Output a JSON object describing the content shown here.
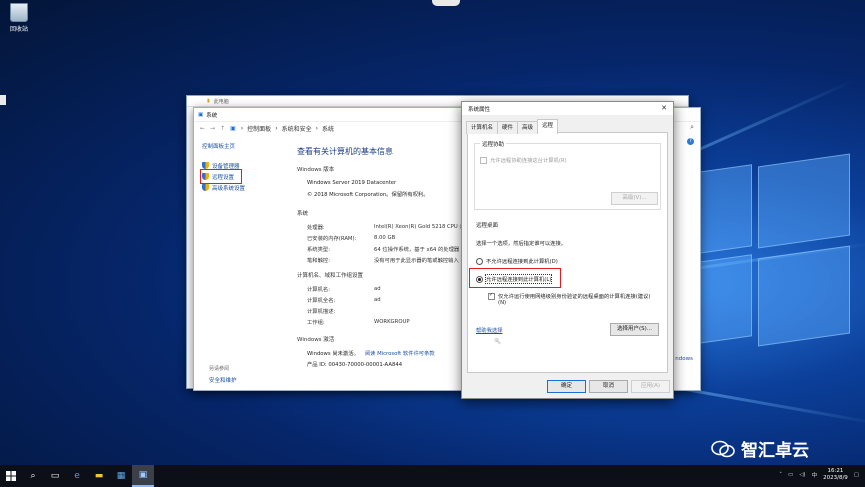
{
  "desktop": {
    "recycle_bin_label": "回收站"
  },
  "bg_window": {
    "title": "此电脑"
  },
  "system_window": {
    "title": "系统",
    "breadcrumb": [
      "控制面板",
      "系统和安全",
      "系统"
    ],
    "left_pane": {
      "home": "控制面板主页",
      "items": [
        "设备管理器",
        "远程设置",
        "高级系统设置"
      ],
      "see_also": "另请参阅",
      "see_also_link": "安全和维护"
    },
    "main": {
      "title": "查看有关计算机的基本信息",
      "edition_header": "Windows 版本",
      "edition_name": "Windows Server 2019 Datacenter",
      "copyright": "© 2018 Microsoft Corporation。保留所有权利。",
      "system_header": "系统",
      "system_rows": [
        {
          "k": "处理器:",
          "v": "Intel(R) Xeon(R) Gold 5218 CPU @"
        },
        {
          "k": "已安装的内存(RAM):",
          "v": "8.00 GB"
        },
        {
          "k": "系统类型:",
          "v": "64 位操作系统，基于 x64 的处理器"
        },
        {
          "k": "笔和触控:",
          "v": "没有可用于此显示器的笔或触控输入"
        }
      ],
      "computer_header": "计算机名、域和工作组设置",
      "computer_rows": [
        {
          "k": "计算机名:",
          "v": "ad"
        },
        {
          "k": "计算机全名:",
          "v": "ad"
        },
        {
          "k": "计算机描述:",
          "v": ""
        },
        {
          "k": "工作组:",
          "v": "WORKGROUP"
        }
      ],
      "activation_header": "Windows 激活",
      "activation_text": "Windows 尚未激活。",
      "activation_link": "阅读 Microsoft 软件许可条款",
      "product_id": "产品 ID: 00430-70000-00001-AA844"
    },
    "right_fragment": "ndows"
  },
  "dialog": {
    "title": "系统属性",
    "tabs": [
      "计算机名",
      "硬件",
      "高级",
      "远程"
    ],
    "active_tab": "远程",
    "remote_assist": {
      "label": "远程协助",
      "checkbox": "允许远程协助连接这台计算机(R)",
      "advanced_button": "高级(V)..."
    },
    "remote_desktop": {
      "label": "远程桌面",
      "prompt": "选择一个选项，然后指定谁可以连接。",
      "opt_deny": "不允许远程连接到此计算机(D)",
      "opt_allow": "允许远程连接到此计算机(L)",
      "nla_checkbox": "仅允许运行使用网络级别身份验证的远程桌面的计算机连接(建议)",
      "nla_suffix": "(N)",
      "help_link": "帮助我选择",
      "select_users_button": "选择用户(S)..."
    },
    "buttons": {
      "ok": "确定",
      "cancel": "取消",
      "apply": "应用(A)"
    }
  },
  "taskbar": {
    "time": "16:21",
    "date": "2023/8/9",
    "ime": "中"
  },
  "watermark": "智汇卓云"
}
